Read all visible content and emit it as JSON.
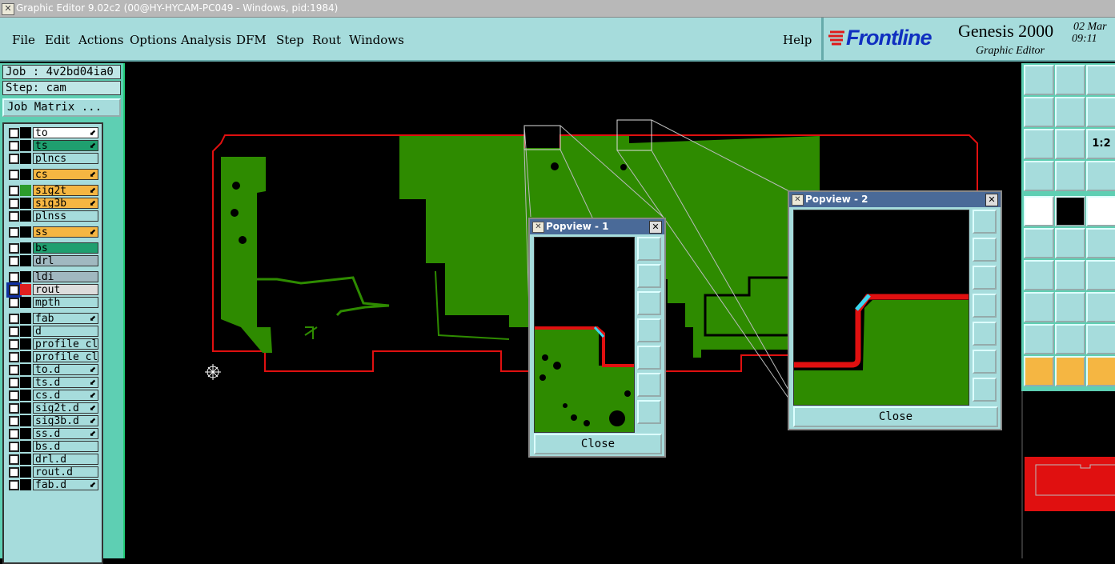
{
  "window": {
    "title": "Graphic Editor 9.02c2 (00@HY-HYCAM-PC049 - Windows, pid:1984)"
  },
  "menu": {
    "items": [
      "File",
      "Edit",
      "Actions",
      "Options",
      "Analysis",
      "DFM",
      "Step",
      "Rout",
      "Windows"
    ],
    "help": "Help"
  },
  "brand": {
    "logo": "Frontline",
    "product": "Genesis 2000",
    "subtitle": "Graphic Editor",
    "date": "02 Mar",
    "time": "09:11"
  },
  "job": {
    "job_label": "Job : 4v2bd04ia0",
    "step_label": "Step: cam",
    "matrix_button": "Job Matrix ..."
  },
  "layers": [
    {
      "name": "to",
      "color": "#ffffff",
      "swatch": "#000000",
      "arrow": true
    },
    {
      "name": "ts",
      "color": "#1f9f6f",
      "swatch": "#000000",
      "arrow": true
    },
    {
      "name": "plncs",
      "color": "#a6dcdc",
      "swatch": "#000000",
      "arrow": false
    },
    {
      "name": "cs",
      "color": "#f5b642",
      "swatch": "#000000",
      "arrow": true
    },
    {
      "name": "sig2t",
      "color": "#f5b642",
      "swatch": "#2c9c2c",
      "arrow": true
    },
    {
      "name": "sig3b",
      "color": "#f5b642",
      "swatch": "#000000",
      "arrow": true
    },
    {
      "name": "plnss",
      "color": "#a6dcdc",
      "swatch": "#000000",
      "arrow": false
    },
    {
      "name": "ss",
      "color": "#f5b642",
      "swatch": "#000000",
      "arrow": true
    },
    {
      "name": "bs",
      "color": "#1f9f6f",
      "swatch": "#000000",
      "arrow": false
    },
    {
      "name": "drl",
      "color": "#a0b8c0",
      "swatch": "#000000",
      "arrow": false
    },
    {
      "name": "ldi",
      "color": "#a0b8c0",
      "swatch": "#000000",
      "arrow": false
    },
    {
      "name": "rout",
      "color": "#dddddd",
      "swatch": "#e02020",
      "arrow": false
    },
    {
      "name": "mpth",
      "color": "#a6dcdc",
      "swatch": "#000000",
      "arrow": false
    },
    {
      "name": "fab",
      "color": "#a6dcdc",
      "swatch": "#000000",
      "arrow": true
    },
    {
      "name": "d",
      "color": "#a6dcdc",
      "swatch": "#000000",
      "arrow": false
    },
    {
      "name": "profile_cli",
      "color": "#a6dcdc",
      "swatch": "#000000",
      "arrow": false
    },
    {
      "name": "profile_cli",
      "color": "#a6dcdc",
      "swatch": "#000000",
      "arrow": false
    },
    {
      "name": "to.d",
      "color": "#a6dcdc",
      "swatch": "#000000",
      "arrow": true
    },
    {
      "name": "ts.d",
      "color": "#a6dcdc",
      "swatch": "#000000",
      "arrow": true
    },
    {
      "name": "cs.d",
      "color": "#a6dcdc",
      "swatch": "#000000",
      "arrow": true
    },
    {
      "name": "sig2t.d",
      "color": "#a6dcdc",
      "swatch": "#000000",
      "arrow": true
    },
    {
      "name": "sig3b.d",
      "color": "#a6dcdc",
      "swatch": "#000000",
      "arrow": true
    },
    {
      "name": "ss.d",
      "color": "#a6dcdc",
      "swatch": "#000000",
      "arrow": true
    },
    {
      "name": "bs.d",
      "color": "#a6dcdc",
      "swatch": "#000000",
      "arrow": false
    },
    {
      "name": "drl.d",
      "color": "#a6dcdc",
      "swatch": "#000000",
      "arrow": false
    },
    {
      "name": "rout.d",
      "color": "#a6dcdc",
      "swatch": "#000000",
      "arrow": false
    },
    {
      "name": "fab.d",
      "color": "#a6dcdc",
      "swatch": "#000000",
      "arrow": true
    }
  ],
  "popview1": {
    "title": "Popview - 1",
    "close": "Close"
  },
  "popview2": {
    "title": "Popview - 2",
    "close": "Close"
  },
  "colors": {
    "board": "#2e8b00",
    "outline": "#e01010",
    "panel": "#a6dcdc",
    "sidebar": "#5ecfb3"
  },
  "icons": {
    "zoom_label": "1:2"
  }
}
